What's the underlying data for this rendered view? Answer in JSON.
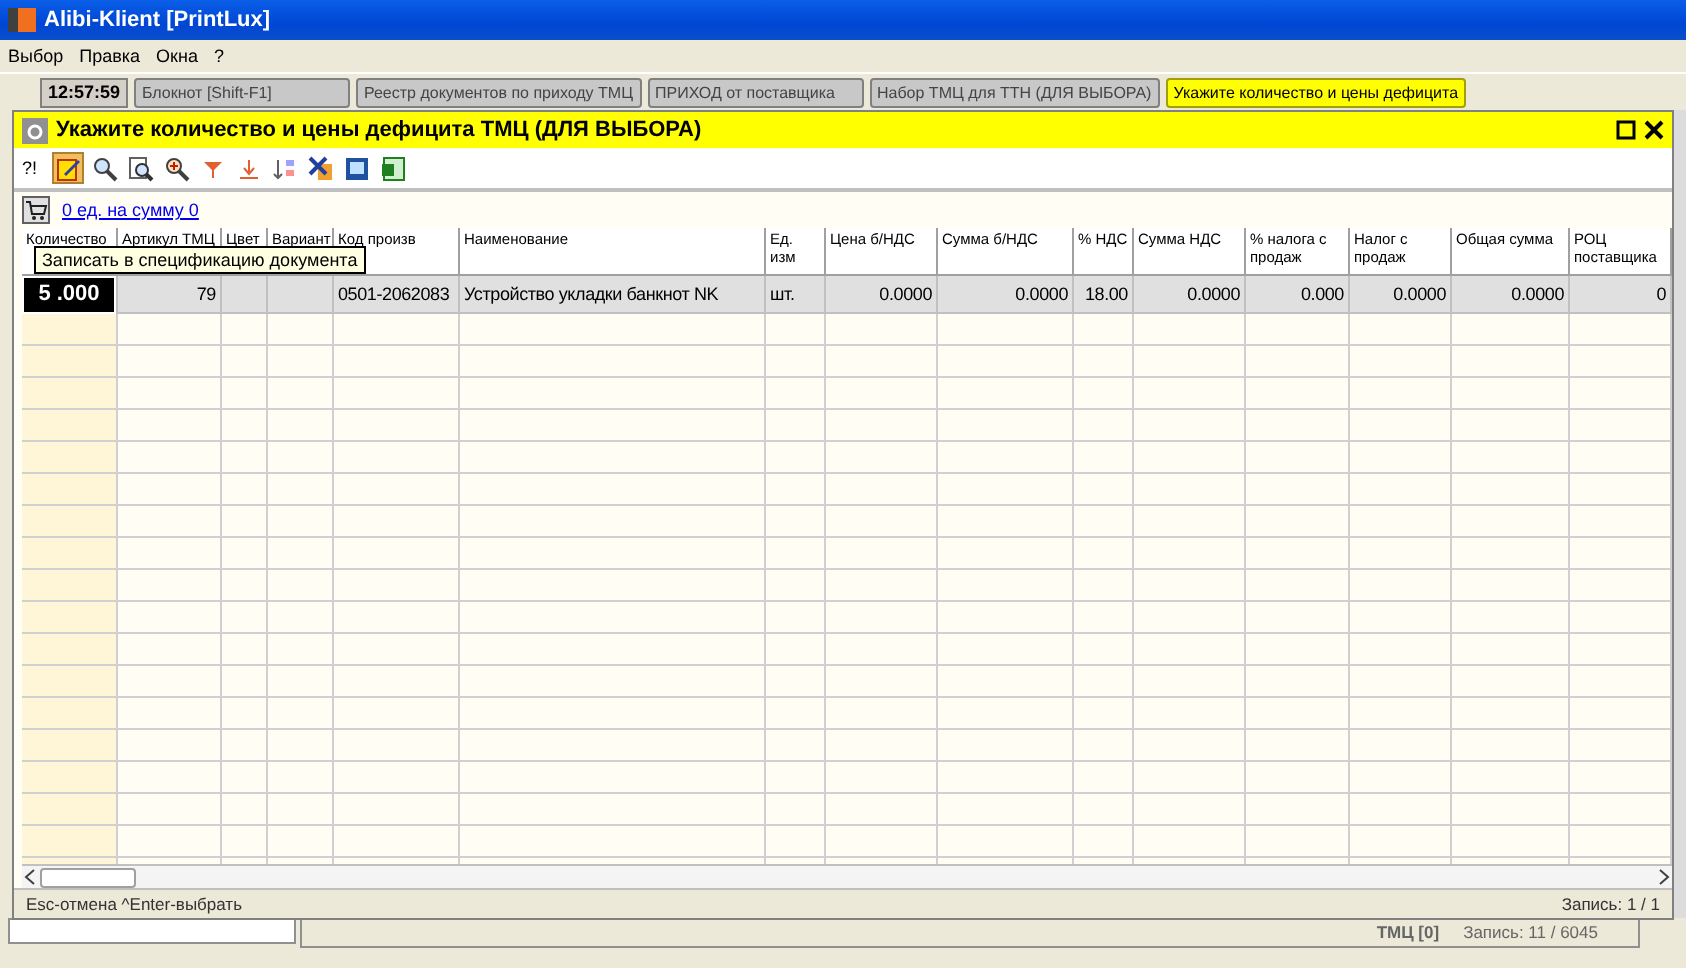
{
  "window": {
    "title": "Alibi-Klient [PrintLux]"
  },
  "menu": [
    "Выбор",
    "Правка",
    "Окна",
    "?"
  ],
  "taskbar": {
    "clock": "12:57:59",
    "tabs": [
      {
        "label": "Блокнот  [Shift-F1]",
        "selected": false
      },
      {
        "label": "Реестр документов по приходу ТМЦ",
        "selected": false
      },
      {
        "label": "ПРИХОД от поставщика",
        "selected": false
      },
      {
        "label": "Набор ТМЦ для ТТН (ДЛЯ ВЫБОРА)",
        "selected": false
      },
      {
        "label": "Укажите количество и цены дефицита",
        "selected": true
      }
    ]
  },
  "dialog": {
    "title": "Укажите количество и цены дефицита ТМЦ (ДЛЯ ВЫБОРА)",
    "toolbar": {
      "help": "?!",
      "tools": [
        {
          "kind": "edit",
          "selected": true
        },
        {
          "kind": "find",
          "selected": false
        },
        {
          "kind": "find-next",
          "selected": false
        },
        {
          "kind": "filter",
          "selected": false
        },
        {
          "kind": "funnel",
          "selected": false
        },
        {
          "kind": "download",
          "selected": false
        },
        {
          "kind": "sort",
          "selected": false
        },
        {
          "kind": "delete",
          "selected": false
        },
        {
          "kind": "preview",
          "selected": false
        },
        {
          "kind": "excel",
          "selected": false
        }
      ]
    },
    "summary_link": "0 ед.  на сумму  0",
    "columns": [
      {
        "label": "Количество"
      },
      {
        "label": "Артикул ТМЦ",
        "numeric": true
      },
      {
        "label": "Цвет"
      },
      {
        "label": "Вариант"
      },
      {
        "label": "Код произв",
        "numeric": false
      },
      {
        "label": "Наименование",
        "numeric": false
      },
      {
        "label": "Ед. изм",
        "numeric": false
      },
      {
        "label": "Цена б/НДС",
        "numeric": true
      },
      {
        "label": "Сумма б/НДС",
        "numeric": true
      },
      {
        "label": "% НДС",
        "numeric": true
      },
      {
        "label": "Сумма НДС",
        "numeric": true
      },
      {
        "label": "% налога с продаж",
        "numeric": true
      },
      {
        "label": "Налог с продаж",
        "numeric": true
      },
      {
        "label": "Общая сумма",
        "numeric": true
      },
      {
        "label": "РОЦ поставщика",
        "numeric": true
      }
    ],
    "rows": [
      {
        "selected": true,
        "cells": [
          "5 .000",
          "79",
          "",
          "",
          "0501-2062083",
          "Устройство укладки банкнот NK",
          "шт.",
          "0.0000",
          "0.0000",
          "18.00",
          "0.0000",
          "0.000",
          "0.0000",
          "0.0000",
          "0"
        ]
      }
    ],
    "tooltip": "Записать в спецификацию документа",
    "status": {
      "hint": "Esc-отмена  ^Enter-выбрать",
      "record": "Запись: 1 / 1"
    }
  },
  "background_window": {
    "count_label": "ТМЦ [0]",
    "record": "Запись: 11 / 6045"
  }
}
